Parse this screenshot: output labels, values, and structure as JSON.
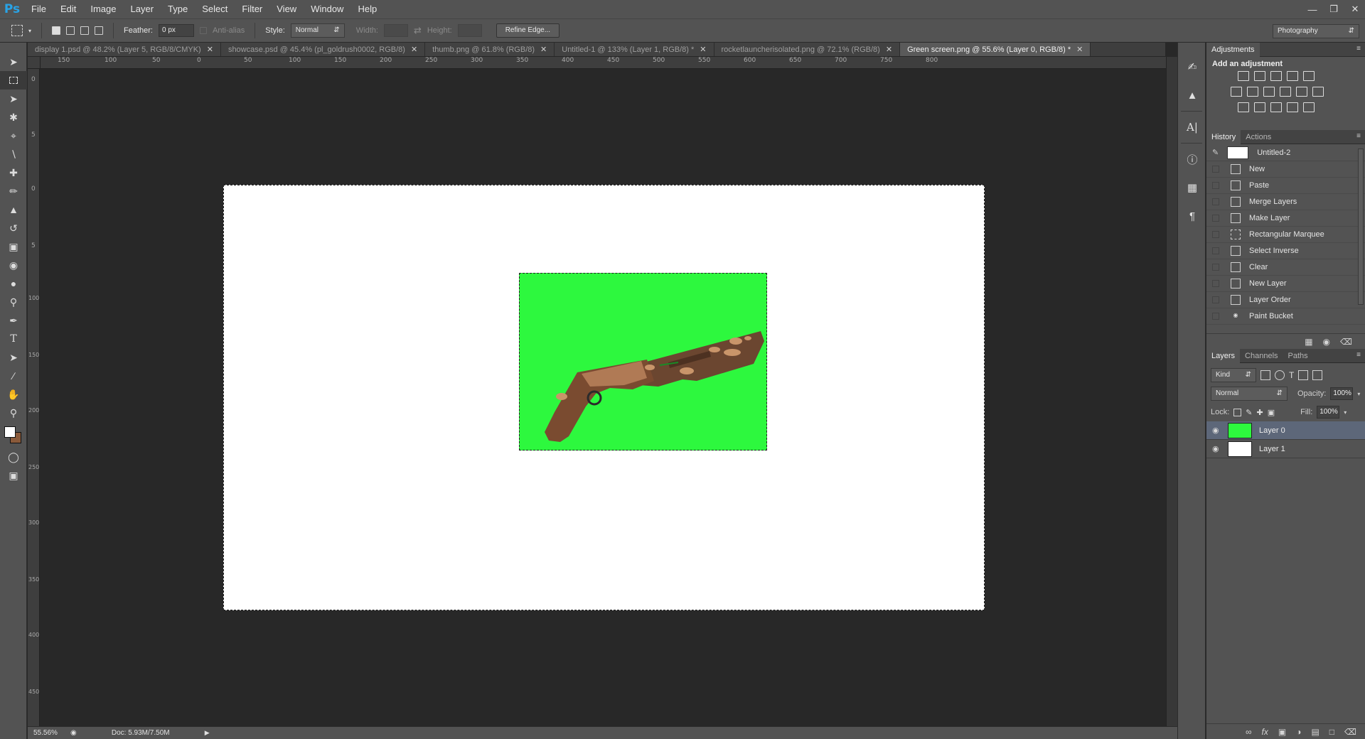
{
  "app": {
    "logo": "Ps",
    "menu": [
      "File",
      "Edit",
      "Image",
      "Layer",
      "Type",
      "Select",
      "Filter",
      "View",
      "Window",
      "Help"
    ],
    "window_controls": [
      "minimize-icon",
      "restore-icon",
      "close-icon"
    ]
  },
  "options_bar": {
    "feather_label": "Feather:",
    "feather_value": "0 px",
    "anti_alias_label": "Anti-alias",
    "style_label": "Style:",
    "style_value": "Normal",
    "width_label": "Width:",
    "height_label": "Height:",
    "refine_edge": "Refine Edge...",
    "workspace": "Photography"
  },
  "tabs": [
    {
      "label": "display 1.psd @ 48.2% (Layer 5, RGB/8/CMYK)",
      "active": false
    },
    {
      "label": "showcase.psd @ 45.4% (pl_goldrush0002, RGB/8)",
      "active": false
    },
    {
      "label": "thumb.png @ 61.8% (RGB/8)",
      "active": false
    },
    {
      "label": "Untitled-1 @ 133% (Layer 1, RGB/8) *",
      "active": false
    },
    {
      "label": "rocketlauncherisolated.png @ 72.1% (RGB/8)",
      "active": false
    },
    {
      "label": "Green screen.png @ 55.6% (Layer 0, RGB/8) *",
      "active": true
    }
  ],
  "ruler": {
    "horizontal": [
      "150",
      "100",
      "50",
      "0",
      "50",
      "100",
      "150",
      "200",
      "250",
      "300",
      "350",
      "400",
      "450",
      "500",
      "550",
      "600",
      "650",
      "700",
      "750",
      "800"
    ],
    "vertical": [
      "0",
      "5",
      "0",
      "5",
      "100",
      "150",
      "200",
      "250",
      "300",
      "350",
      "400",
      "450"
    ]
  },
  "status": {
    "zoom": "55.56%",
    "doc": "Doc: 5.93M/7.50M"
  },
  "adjustments": {
    "tab": "Adjustments",
    "title": "Add an adjustment"
  },
  "history": {
    "tabs": [
      "History",
      "Actions"
    ],
    "snapshot": "Untitled-2",
    "items": [
      "New",
      "Paste",
      "Merge Layers",
      "Make Layer",
      "Rectangular Marquee",
      "Select Inverse",
      "Clear",
      "New Layer",
      "Layer Order",
      "Paint Bucket"
    ]
  },
  "layers": {
    "tabs": [
      "Layers",
      "Channels",
      "Paths"
    ],
    "kind": "Kind",
    "blend_mode": "Normal",
    "opacity_label": "Opacity:",
    "opacity_value": "100%",
    "lock_label": "Lock:",
    "fill_label": "Fill:",
    "fill_value": "100%",
    "items": [
      {
        "name": "Layer 0",
        "selected": true
      },
      {
        "name": "Layer 1",
        "selected": false
      }
    ]
  }
}
